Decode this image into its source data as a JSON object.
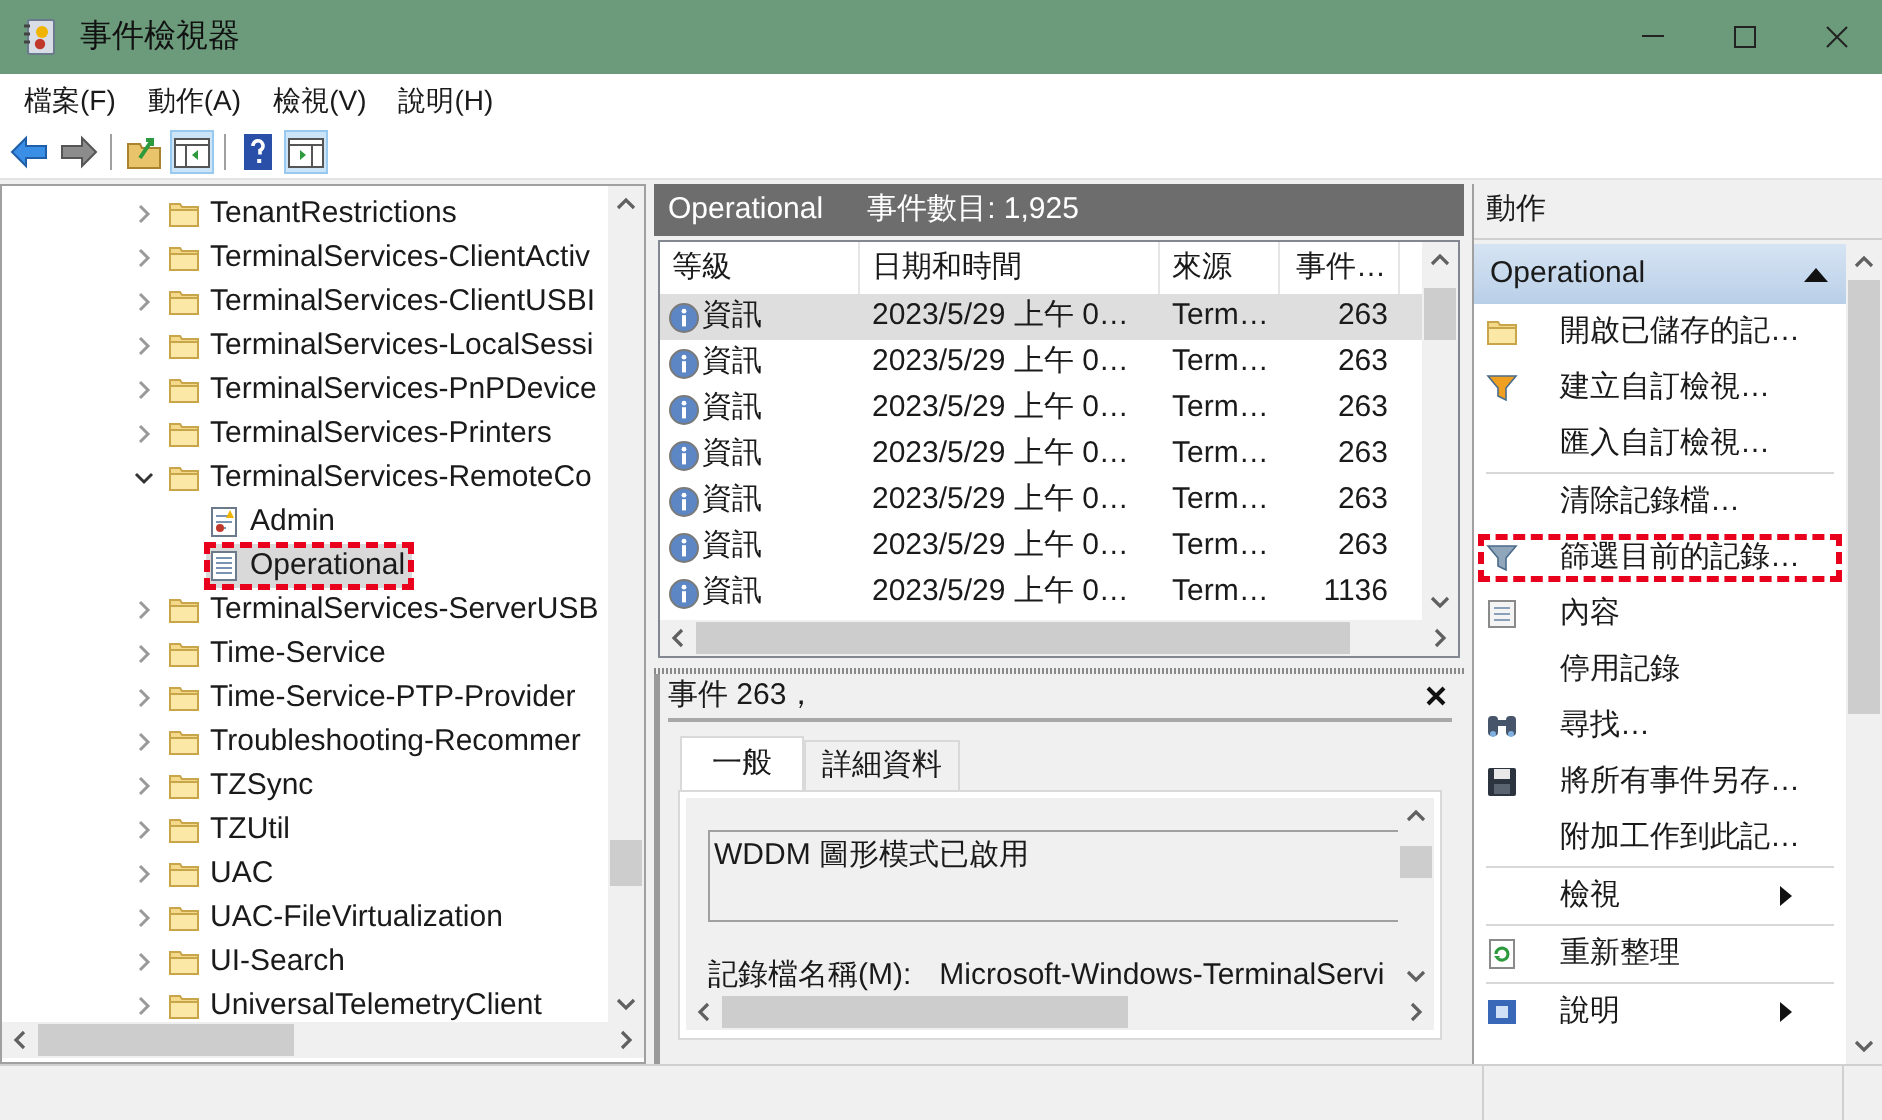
{
  "window": {
    "title": "事件檢視器"
  },
  "menu": [
    "檔案(F)",
    "動作(A)",
    "檢視(V)",
    "說明(H)"
  ],
  "toolbar": [
    {
      "kind": "back",
      "pressed": false
    },
    {
      "kind": "forward",
      "pressed": false
    },
    {
      "kind": "separator"
    },
    {
      "kind": "up",
      "pressed": false
    },
    {
      "kind": "tree-pane",
      "pressed": true
    },
    {
      "kind": "separator"
    },
    {
      "kind": "help",
      "pressed": false
    },
    {
      "kind": "action-pane",
      "pressed": true
    }
  ],
  "tree": [
    {
      "label": "TenantRestrictions",
      "kind": "folder",
      "expanded": false,
      "selected": false
    },
    {
      "label": "TerminalServices-ClientActiv",
      "kind": "folder",
      "expanded": false,
      "selected": false
    },
    {
      "label": "TerminalServices-ClientUSBI",
      "kind": "folder",
      "expanded": false,
      "selected": false
    },
    {
      "label": "TerminalServices-LocalSessi",
      "kind": "folder",
      "expanded": false,
      "selected": false
    },
    {
      "label": "TerminalServices-PnPDevice",
      "kind": "folder",
      "expanded": false,
      "selected": false
    },
    {
      "label": "TerminalServices-Printers",
      "kind": "folder",
      "expanded": false,
      "selected": false
    },
    {
      "label": "TerminalServices-RemoteCo",
      "kind": "folder",
      "expanded": true,
      "selected": false,
      "children": [
        {
          "label": "Admin",
          "kind": "admin-log",
          "selected": false
        },
        {
          "label": "Operational",
          "kind": "log",
          "selected": true,
          "highlighted": true
        }
      ]
    },
    {
      "label": "TerminalServices-ServerUSB",
      "kind": "folder",
      "expanded": false,
      "selected": false
    },
    {
      "label": "Time-Service",
      "kind": "folder",
      "expanded": false,
      "selected": false
    },
    {
      "label": "Time-Service-PTP-Provider",
      "kind": "folder",
      "expanded": false,
      "selected": false
    },
    {
      "label": "Troubleshooting-Recommer",
      "kind": "folder",
      "expanded": false,
      "selected": false
    },
    {
      "label": "TZSync",
      "kind": "folder",
      "expanded": false,
      "selected": false
    },
    {
      "label": "TZUtil",
      "kind": "folder",
      "expanded": false,
      "selected": false
    },
    {
      "label": "UAC",
      "kind": "folder",
      "expanded": false,
      "selected": false
    },
    {
      "label": "UAC-FileVirtualization",
      "kind": "folder",
      "expanded": false,
      "selected": false
    },
    {
      "label": "UI-Search",
      "kind": "folder",
      "expanded": false,
      "selected": false
    },
    {
      "label": "UniversalTelemetryClient",
      "kind": "folder",
      "expanded": false,
      "selected": false
    }
  ],
  "events": {
    "title": "Operational",
    "count": "事件數目: 1,925",
    "columns": [
      "等級",
      "日期和時間",
      "來源",
      "事件…"
    ],
    "rows": [
      {
        "level": "資訊",
        "date": "2023/5/29 上午 0…",
        "source": "Term…",
        "event_id": "263",
        "selected": true
      },
      {
        "level": "資訊",
        "date": "2023/5/29 上午 0…",
        "source": "Term…",
        "event_id": "263",
        "selected": false
      },
      {
        "level": "資訊",
        "date": "2023/5/29 上午 0…",
        "source": "Term…",
        "event_id": "263",
        "selected": false
      },
      {
        "level": "資訊",
        "date": "2023/5/29 上午 0…",
        "source": "Term…",
        "event_id": "263",
        "selected": false
      },
      {
        "level": "資訊",
        "date": "2023/5/29 上午 0…",
        "source": "Term…",
        "event_id": "263",
        "selected": false
      },
      {
        "level": "資訊",
        "date": "2023/5/29 上午 0…",
        "source": "Term…",
        "event_id": "263",
        "selected": false
      },
      {
        "level": "資訊",
        "date": "2023/5/29 上午 0…",
        "source": "Term…",
        "event_id": "1136",
        "selected": false
      }
    ]
  },
  "detail": {
    "title": "事件 263，",
    "tabs": [
      {
        "label": "一般",
        "selected": true
      },
      {
        "label": "詳細資料",
        "selected": false
      }
    ],
    "description": "WDDM 圖形模式已啟用",
    "field_label": "記錄檔名稱(M):",
    "field_value": "Microsoft-Windows-TerminalServi"
  },
  "actions": {
    "title": "動作",
    "section": {
      "label": "Operational",
      "expanded": true
    },
    "items": [
      {
        "label": "開啟已儲存的記…",
        "kind": "open"
      },
      {
        "label": "建立自訂檢視…",
        "kind": "create"
      },
      {
        "label": "匯入自訂檢視…",
        "kind": "plain"
      },
      {
        "label": "清除記錄檔…",
        "kind": "plain",
        "separator_before": true
      },
      {
        "label": "篩選目前的記錄…",
        "kind": "filter",
        "highlighted": true
      },
      {
        "label": "內容",
        "kind": "properties"
      },
      {
        "label": "停用記錄",
        "kind": "plain"
      },
      {
        "label": "尋找…",
        "kind": "find"
      },
      {
        "label": "將所有事件另存…",
        "kind": "save"
      },
      {
        "label": "附加工作到此記…",
        "kind": "plain"
      },
      {
        "label": "檢視",
        "kind": "submenu",
        "separator_before": true
      },
      {
        "label": "重新整理",
        "kind": "refresh",
        "separator_before": true
      },
      {
        "label": "說明",
        "kind": "help",
        "separator_before": true
      }
    ]
  }
}
